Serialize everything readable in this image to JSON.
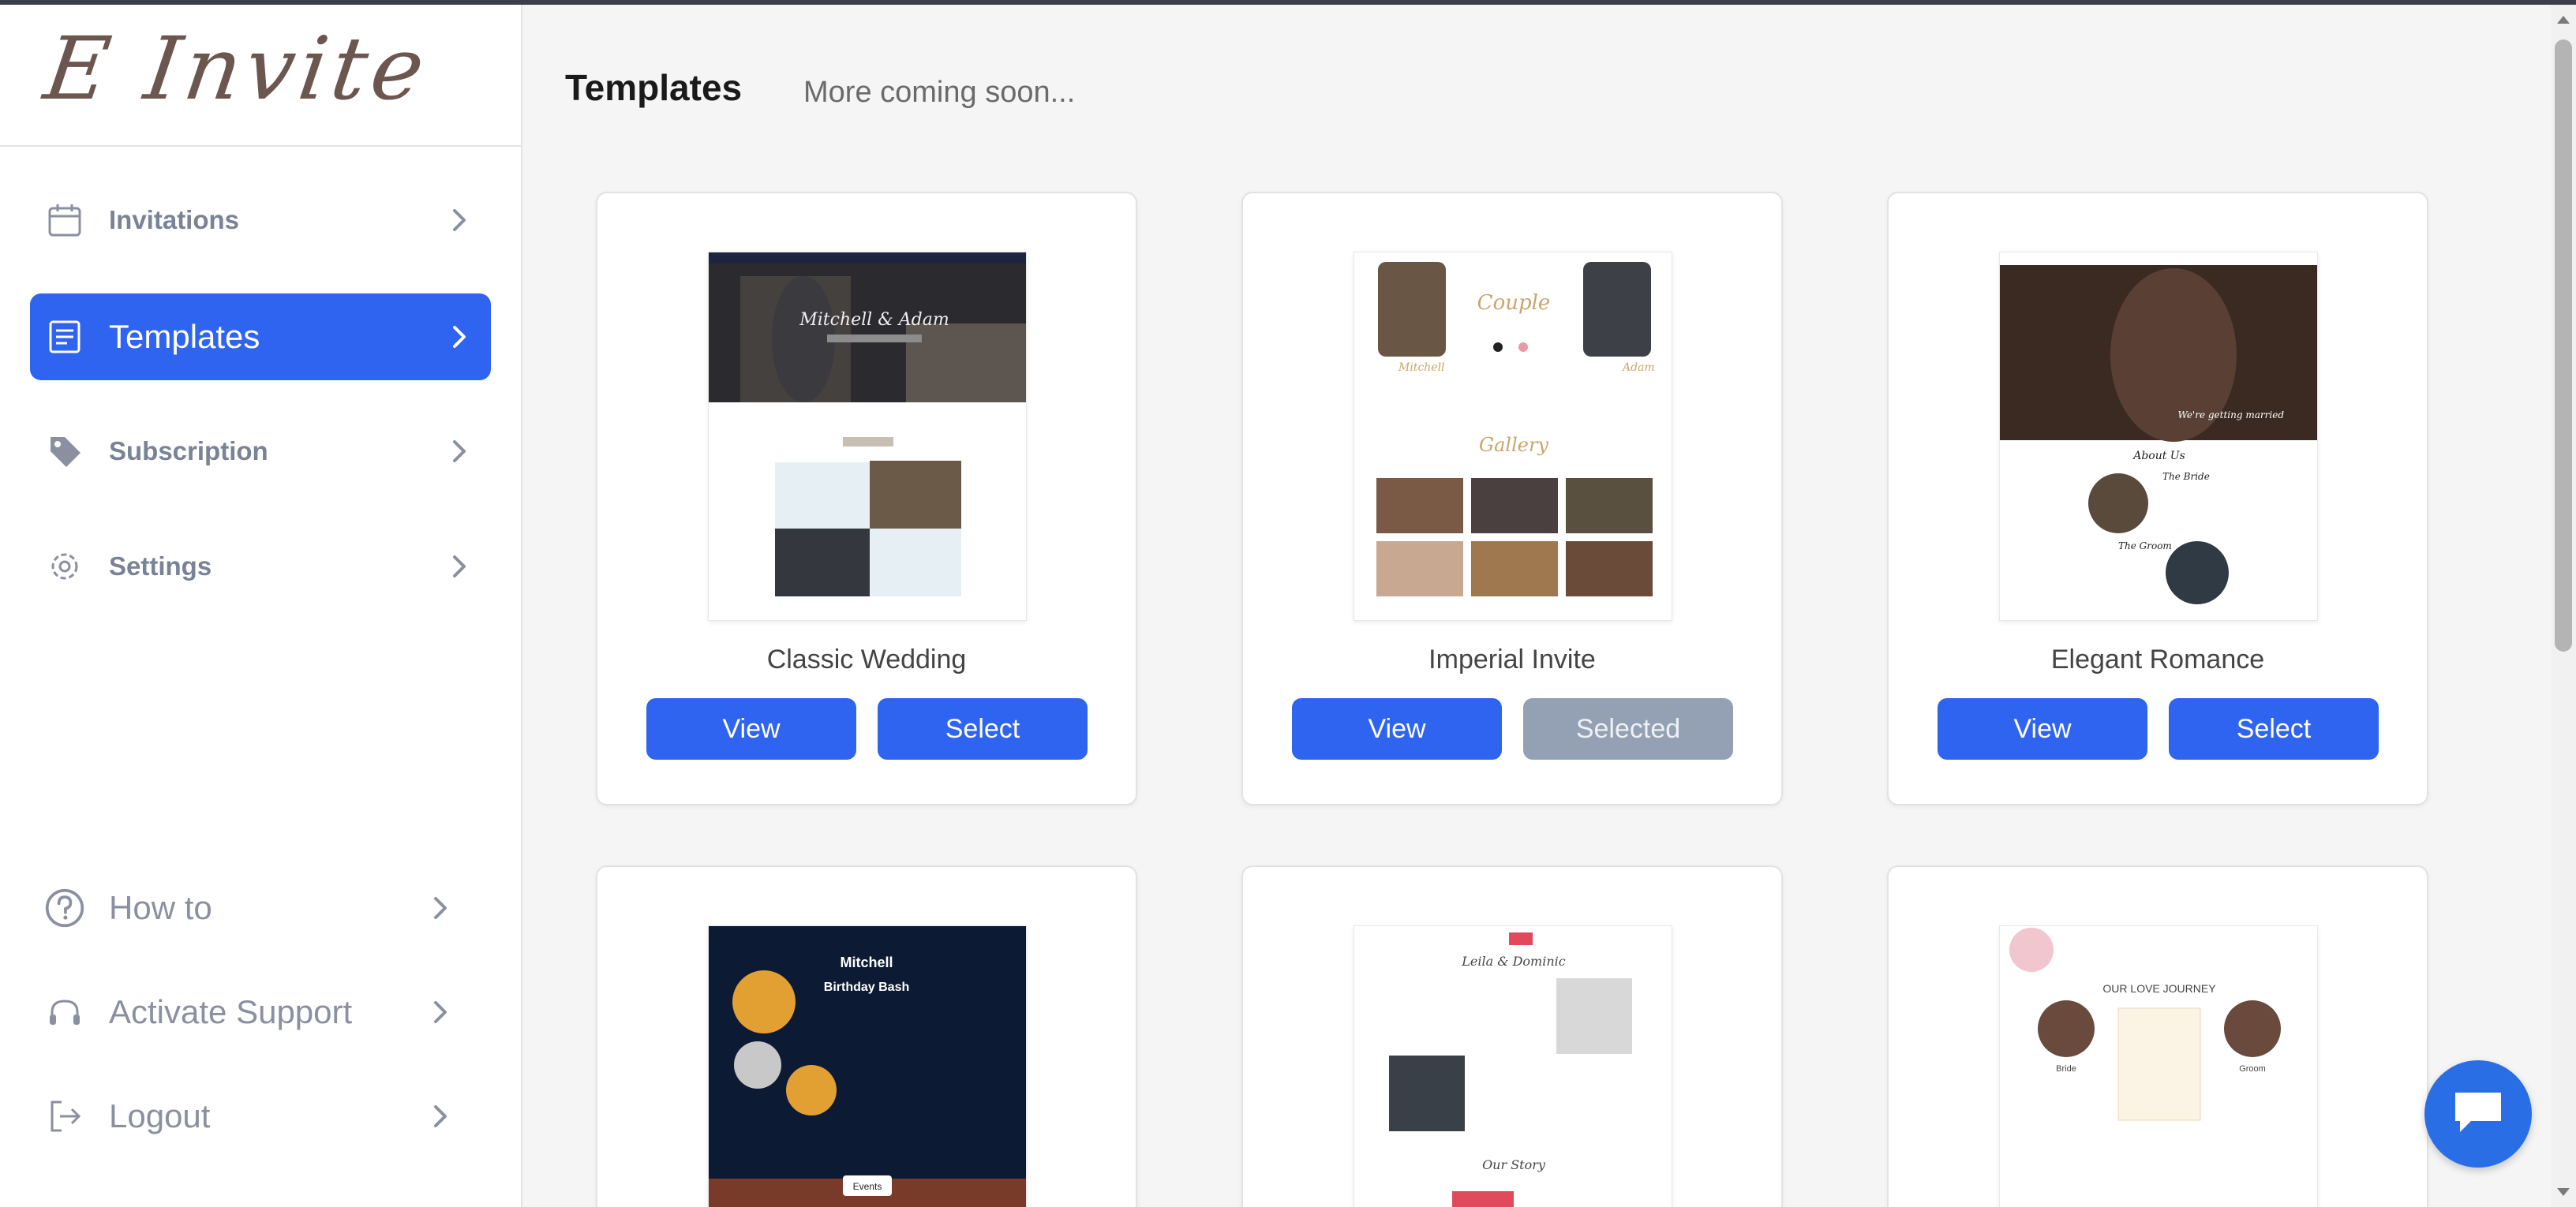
{
  "brand": {
    "logo_text": "E Invite"
  },
  "sidebar": {
    "items": [
      {
        "label": "Invitations",
        "icon": "calendar-icon"
      },
      {
        "label": "Templates",
        "icon": "document-icon",
        "active": true
      },
      {
        "label": "Subscription",
        "icon": "tag-icon"
      },
      {
        "label": "Settings",
        "icon": "gear-icon"
      }
    ],
    "bottom_items": [
      {
        "label": "How to",
        "icon": "help-circle-icon"
      },
      {
        "label": "Activate Support",
        "icon": "headset-icon"
      },
      {
        "label": "Logout",
        "icon": "logout-icon"
      }
    ]
  },
  "main": {
    "title": "Templates",
    "subtitle": "More coming soon...",
    "templates": [
      {
        "name": "Classic Wedding",
        "view_label": "View",
        "select_label": "Select",
        "selected": false,
        "preview": {
          "names": "Mitchell & Adam"
        }
      },
      {
        "name": "Imperial Invite",
        "view_label": "View",
        "select_label": "Selected",
        "selected": true,
        "preview": {
          "heading": "Couple",
          "gallery": "Gallery",
          "left_name": "Mitchell",
          "right_name": "Adam"
        }
      },
      {
        "name": "Elegant Romance",
        "view_label": "View",
        "select_label": "Select",
        "selected": false,
        "preview": {
          "about": "About Us",
          "bride": "The Bride",
          "groom": "The Groom",
          "tagline": "We're getting married"
        }
      },
      {
        "name": "",
        "preview": {
          "line1": "Mitchell",
          "line2": "Birthday Bash",
          "tag": "Events"
        }
      },
      {
        "name": "",
        "preview": {
          "names": "Leila & Dominic",
          "story": "Our Story"
        }
      },
      {
        "name": "",
        "preview": {
          "heading": "OUR LOVE JOURNEY",
          "bride": "Bride",
          "groom": "Groom"
        }
      }
    ]
  },
  "colors": {
    "primary": "#2f64f0",
    "selected_button": "#94a0b4",
    "chat_button": "#2a6ee6"
  }
}
